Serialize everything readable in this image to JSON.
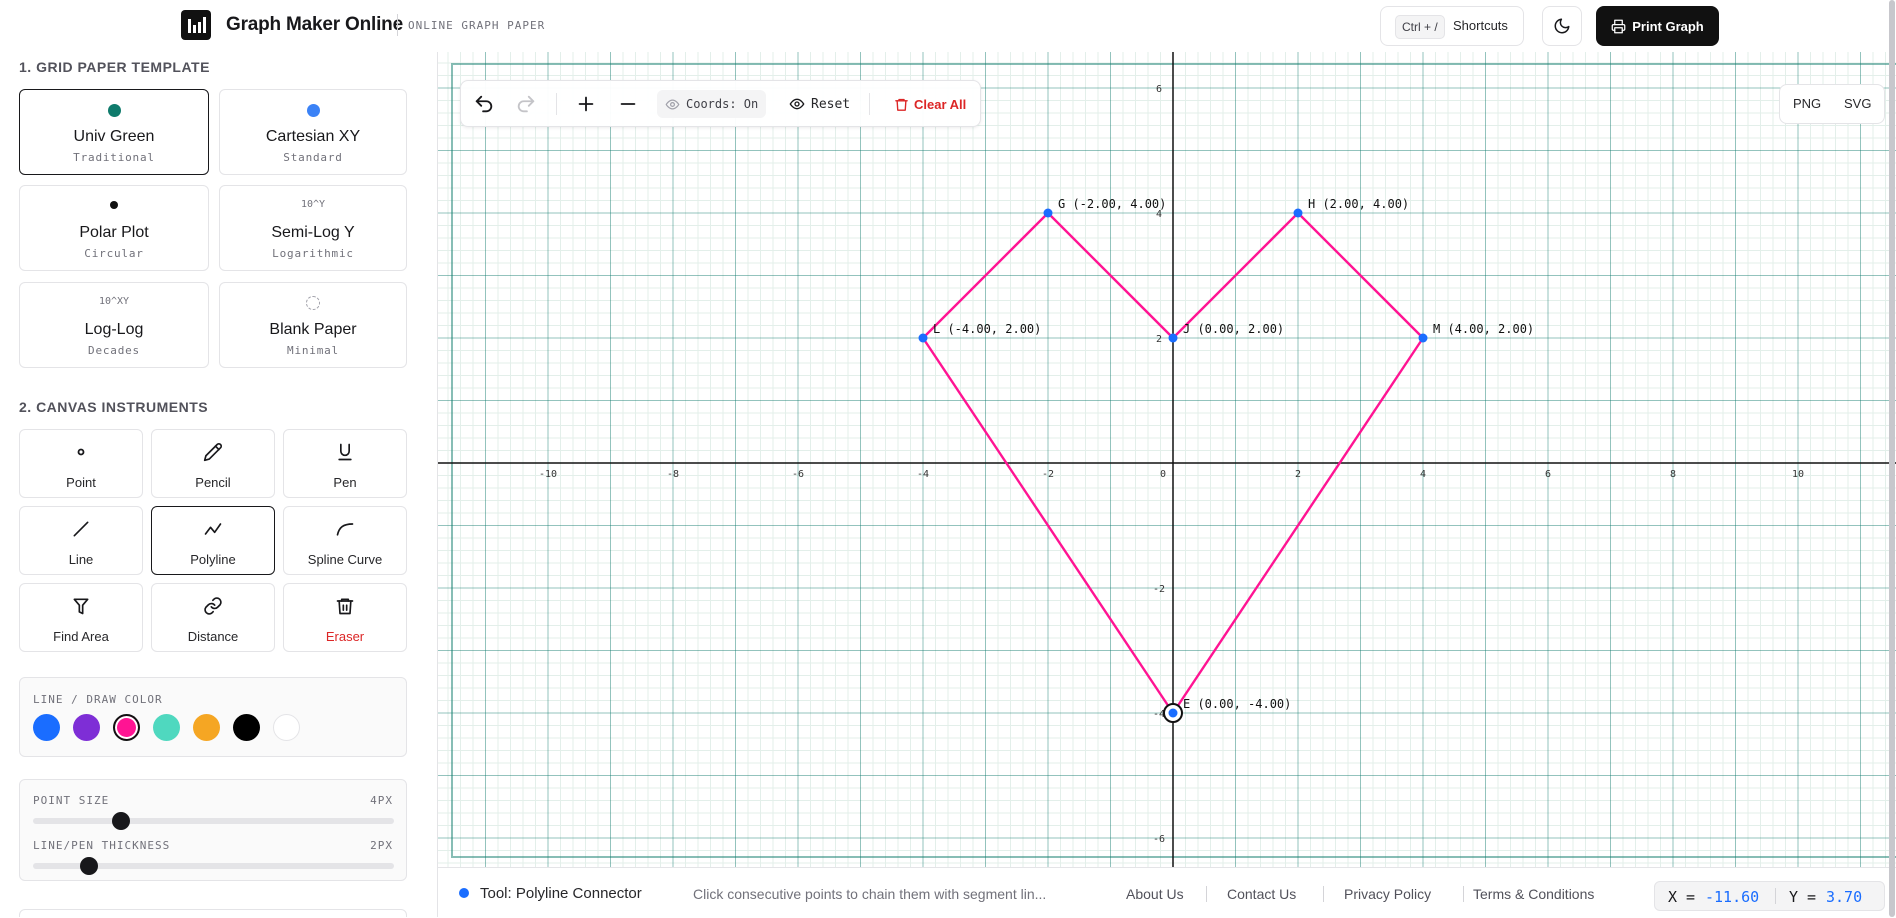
{
  "header": {
    "brand": "Graph Maker Online",
    "subtitle": "ONLINE GRAPH PAPER",
    "shortcut_key": "Ctrl + /",
    "shortcuts_label": "Shortcuts",
    "print_label": "Print Graph"
  },
  "sidebar": {
    "templates_title": "1. GRID PAPER TEMPLATE",
    "templates": [
      {
        "name": "Univ Green",
        "sub": "Traditional",
        "icon": "green-dot-icon",
        "selected": true
      },
      {
        "name": "Cartesian XY",
        "sub": "Standard",
        "icon": "blue-dot-icon"
      },
      {
        "name": "Polar Plot",
        "sub": "Circular",
        "icon": "black-dot-icon"
      },
      {
        "name": "Semi-Log Y",
        "sub": "Logarithmic",
        "icon_text": "10^Y"
      },
      {
        "name": "Log-Log",
        "sub": "Decades",
        "icon_text": "10^XY"
      },
      {
        "name": "Blank Paper",
        "sub": "Minimal",
        "icon": "dashed-circle-icon"
      }
    ],
    "instruments_title": "2. CANVAS INSTRUMENTS",
    "tools": [
      {
        "label": "Point",
        "icon": "point-icon"
      },
      {
        "label": "Pencil",
        "icon": "pencil-icon"
      },
      {
        "label": "Pen",
        "icon": "pen-icon"
      },
      {
        "label": "Line",
        "icon": "line-icon"
      },
      {
        "label": "Polyline",
        "icon": "polyline-icon",
        "selected": true
      },
      {
        "label": "Spline Curve",
        "icon": "spline-icon"
      },
      {
        "label": "Find Area",
        "icon": "area-icon"
      },
      {
        "label": "Distance",
        "icon": "link-icon"
      },
      {
        "label": "Eraser",
        "icon": "trash-icon"
      }
    ],
    "color_label": "LINE / DRAW COLOR",
    "colors": [
      "#1a6dff",
      "#7e2ed6",
      "#ff1493",
      "#4fd8bf",
      "#f5a623",
      "#000000",
      "#ffffff"
    ],
    "selected_color": "#ff1493",
    "point_size_label": "POINT SIZE",
    "point_size_value": "4PX",
    "point_size_level": 0.22,
    "thickness_label": "LINE/PEN THICKNESS",
    "thickness_value": "2PX",
    "thickness_level": 0.13
  },
  "toolbar": {
    "coords_label": "Coords: On",
    "reset_label": "Reset",
    "clear_label": "Clear All"
  },
  "export": {
    "png": "PNG",
    "svg": "SVG"
  },
  "graph": {
    "x_ticks": [
      -10,
      -8,
      -6,
      -4,
      -2,
      0,
      2,
      4,
      6,
      8,
      10
    ],
    "y_ticks": [
      6,
      4,
      2,
      -2,
      -4,
      -6
    ],
    "points": [
      {
        "name": "G",
        "x": -2,
        "y": 4,
        "label": "G (-2.00, 4.00)"
      },
      {
        "name": "H",
        "x": 2,
        "y": 4,
        "label": "H (2.00, 4.00)"
      },
      {
        "name": "L",
        "x": -4,
        "y": 2,
        "label": "L (-4.00, 2.00)"
      },
      {
        "name": "J",
        "x": 0,
        "y": 2,
        "label": "J (0.00, 2.00)"
      },
      {
        "name": "M",
        "x": 4,
        "y": 2,
        "label": "M (4.00, 2.00)"
      },
      {
        "name": "E",
        "x": 0,
        "y": -4,
        "label": "E (0.00, -4.00)"
      }
    ],
    "polyline": [
      [
        0,
        -4
      ],
      [
        -4,
        2
      ],
      [
        -2,
        4
      ],
      [
        0,
        2
      ],
      [
        2,
        4
      ],
      [
        4,
        2
      ],
      [
        0,
        -4
      ]
    ],
    "line_color": "#ff1493",
    "point_color": "#1a6dff",
    "grid_color": "#0f7b6c"
  },
  "footer": {
    "tool": "Tool: Polyline Connector",
    "hint": "Click consecutive points to chain them with segment lin...",
    "links": [
      "About Us",
      "Contact Us",
      "Privacy Policy",
      "Terms & Conditions"
    ],
    "x_key": "X =",
    "x_val": "-11.60",
    "y_key": "Y =",
    "y_val": "3.70"
  }
}
